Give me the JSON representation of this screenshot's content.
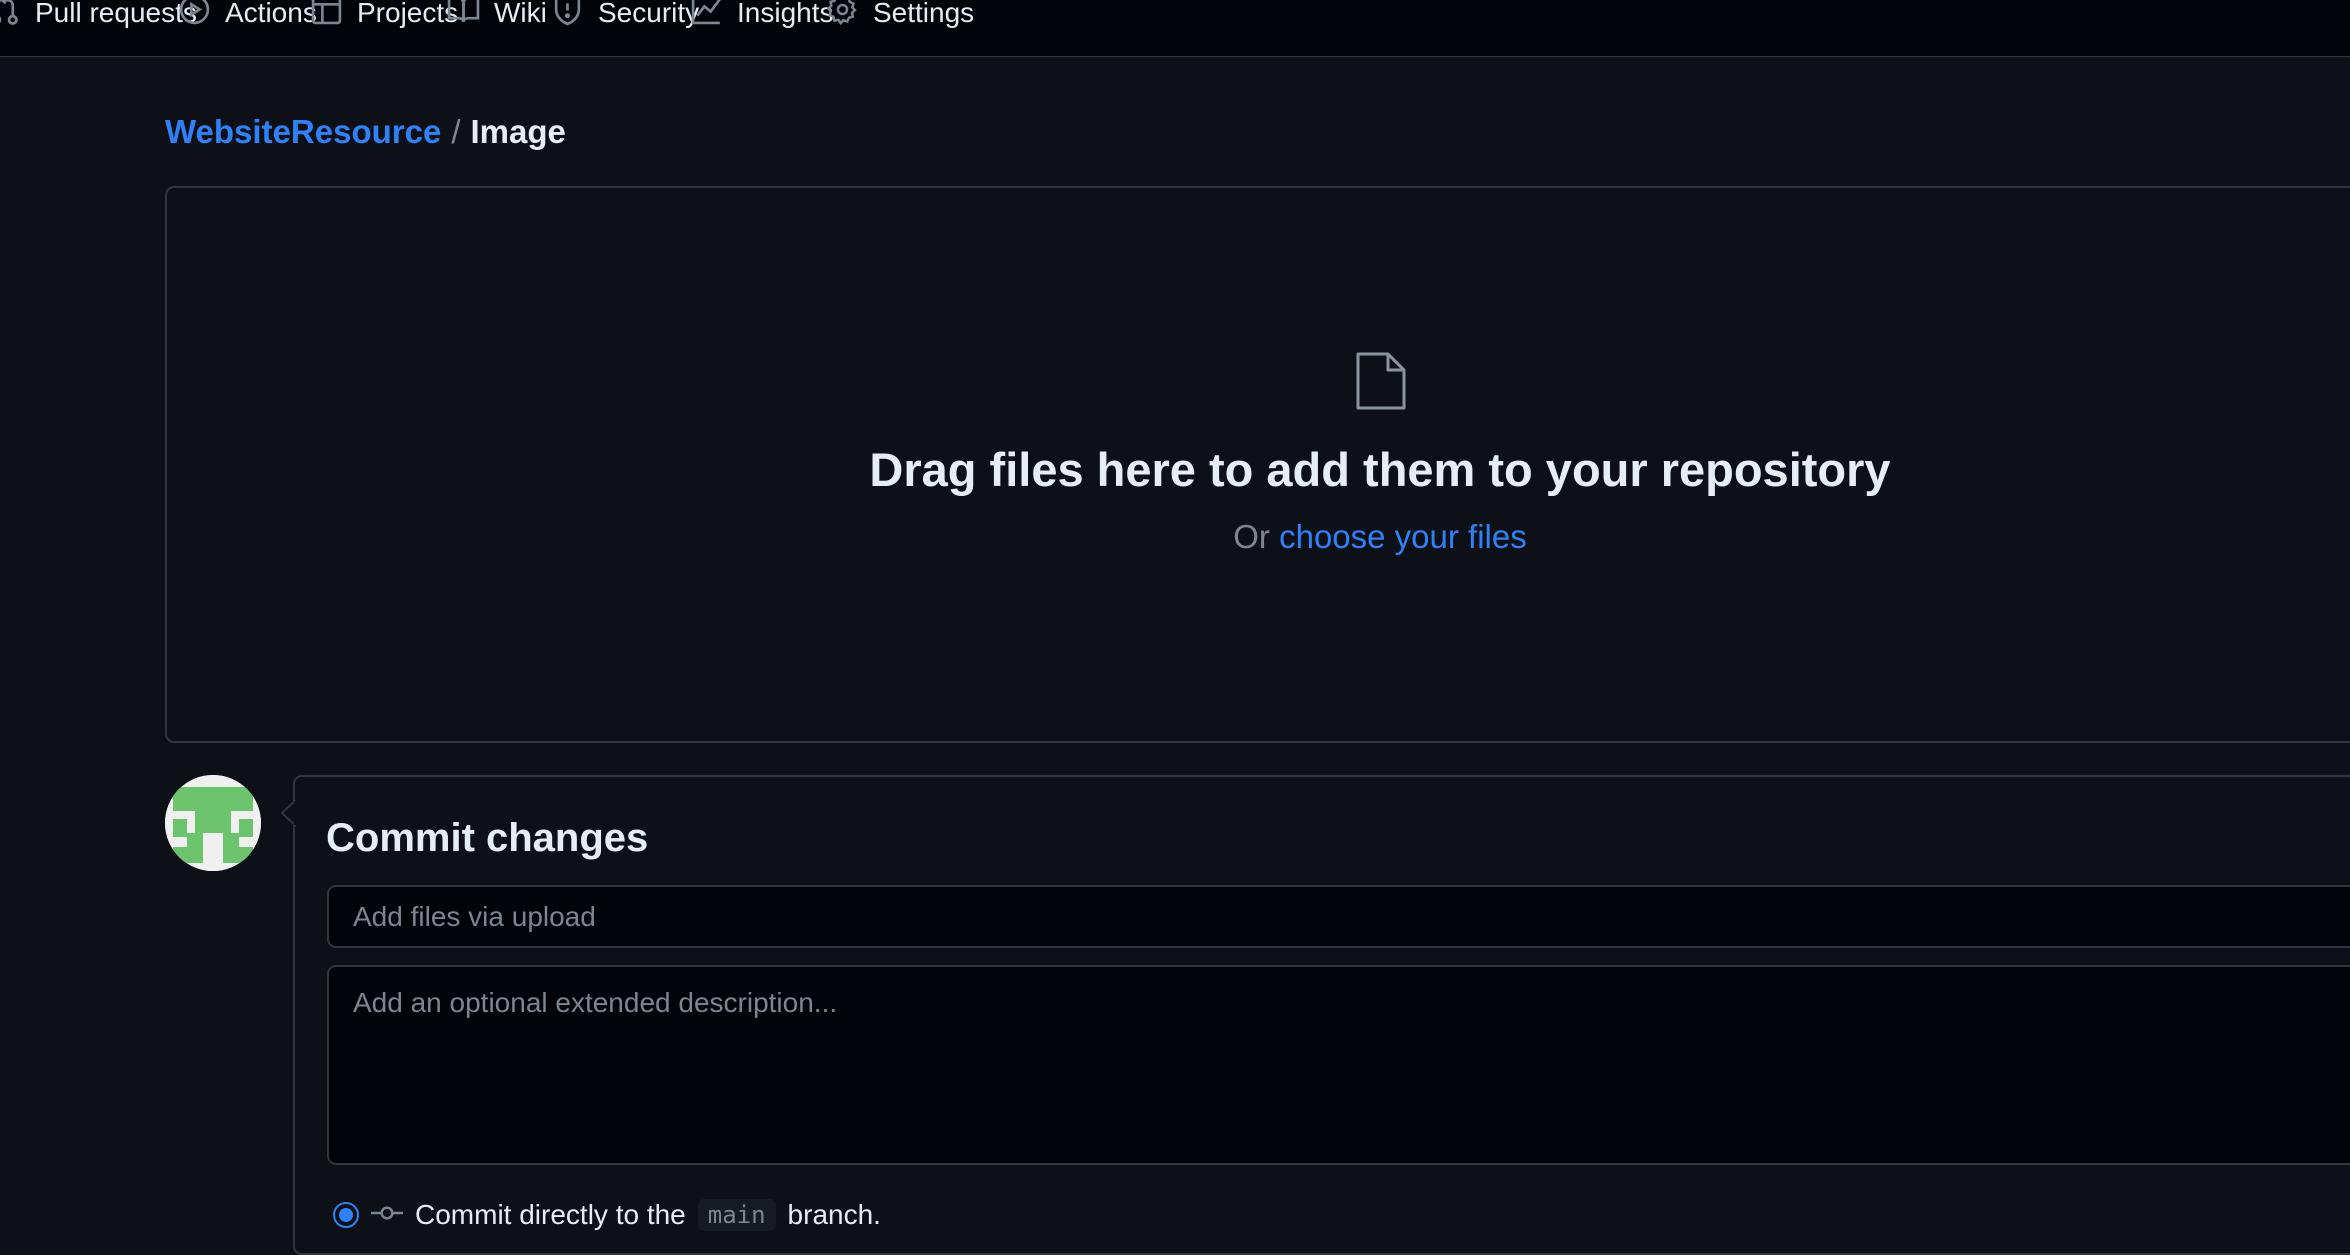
{
  "nav": {
    "items": [
      {
        "label": "Pull requests",
        "icon": "git-pull-request-icon"
      },
      {
        "label": "Actions",
        "icon": "play-icon"
      },
      {
        "label": "Projects",
        "icon": "table-icon"
      },
      {
        "label": "Wiki",
        "icon": "book-icon"
      },
      {
        "label": "Security",
        "icon": "shield-icon"
      },
      {
        "label": "Insights",
        "icon": "graph-icon"
      },
      {
        "label": "Settings",
        "icon": "gear-icon"
      }
    ]
  },
  "breadcrumb": {
    "repo": "WebsiteResource",
    "separator": "/",
    "current": "Image"
  },
  "upload": {
    "icon": "file-icon",
    "title": "Drag files here to add them to your repository",
    "or_text": "Or",
    "choose_link": "choose your files"
  },
  "commit": {
    "title": "Commit changes",
    "summary_placeholder": "Add files via upload",
    "description_placeholder": "Add an optional extended description...",
    "option_prefix": "Commit directly to the",
    "branch": "main",
    "option_suffix": "branch."
  },
  "colors": {
    "background": "#0d1117",
    "nav_background": "#010409",
    "border": "#30363d",
    "link": "#2f81f7",
    "muted": "#7d8590",
    "text": "#e6edf3",
    "avatar_green": "#6cc46c"
  }
}
